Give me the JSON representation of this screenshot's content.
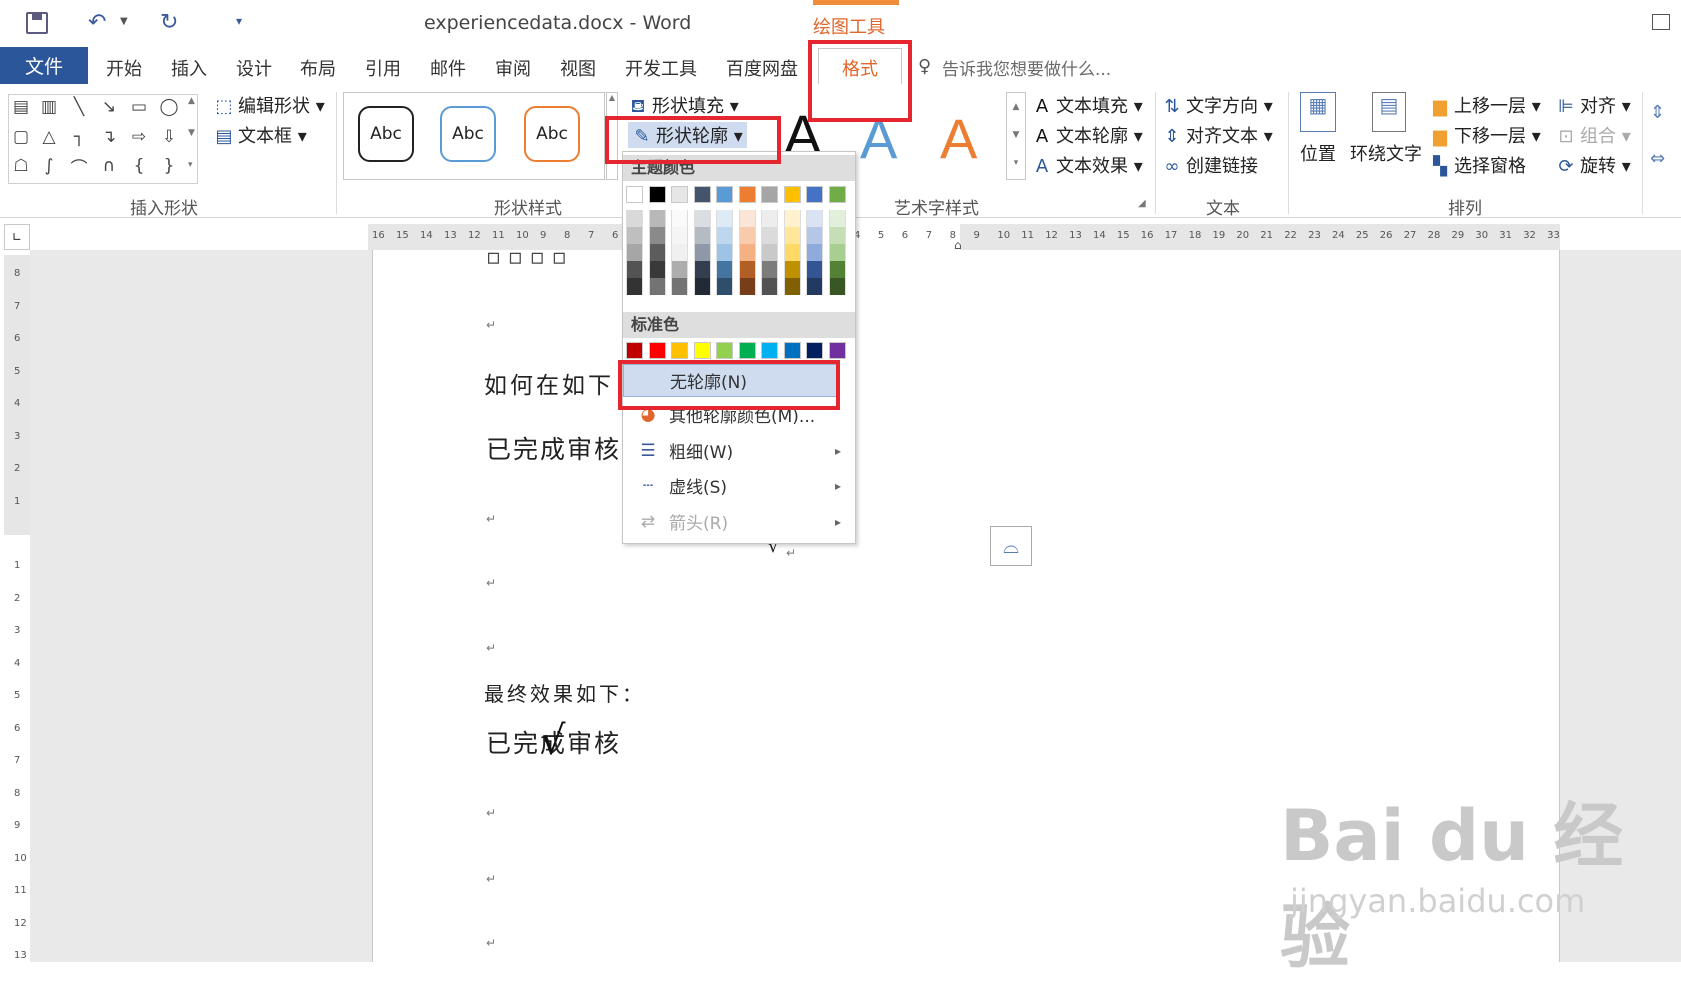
{
  "window": {
    "title": "experiencedata.docx - Word",
    "context_tab_label": "绘图工具"
  },
  "tabs": [
    "文件",
    "开始",
    "插入",
    "设计",
    "布局",
    "引用",
    "邮件",
    "审阅",
    "视图",
    "开发工具",
    "百度网盘",
    "格式"
  ],
  "tell_me": "告诉我您想要做什么...",
  "ribbon": {
    "insert_shapes": {
      "label": "插入形状",
      "edit_shape": "编辑形状",
      "text_box": "文本框"
    },
    "shape_styles": {
      "label": "形状样式",
      "samples": [
        "Abc",
        "Abc",
        "Abc"
      ],
      "fill": "形状填充",
      "outline": "形状轮廓"
    },
    "wordart": {
      "label": "艺术字样式",
      "letters": [
        "A",
        "A",
        "A"
      ],
      "text_fill": "文本填充",
      "text_outline": "文本轮廓",
      "text_effects": "文本效果"
    },
    "text": {
      "label": "文本",
      "direction": "文字方向",
      "align": "对齐文本",
      "link": "创建链接"
    },
    "arrange": {
      "label": "排列",
      "position": "位置",
      "wrap": "环绕文字",
      "forward": "上移一层",
      "backward": "下移一层",
      "pane": "选择窗格",
      "align": "对齐",
      "group": "组合",
      "rotate": "旋转"
    }
  },
  "ruler_h_left": [
    "16",
    "15",
    "14",
    "13",
    "12",
    "11",
    "10",
    "9",
    "8",
    "7",
    "6"
  ],
  "ruler_h_right": [
    "4",
    "5",
    "6",
    "7",
    "8",
    "9",
    "10",
    "11",
    "12",
    "13",
    "14",
    "15",
    "16",
    "17",
    "18",
    "19",
    "20",
    "21",
    "22",
    "23",
    "24",
    "25",
    "26",
    "27",
    "28",
    "29",
    "30",
    "31",
    "32",
    "33"
  ],
  "ruler_v_top": [
    "8",
    "7",
    "6",
    "5",
    "4",
    "3",
    "2",
    "1"
  ],
  "ruler_v_bottom": [
    "1",
    "2",
    "3",
    "4",
    "5",
    "6",
    "7",
    "8",
    "9",
    "10",
    "11",
    "12",
    "13"
  ],
  "document": {
    "p1": "如何在如下",
    "p2": "已完成审核",
    "p3": "最终效果如下：",
    "p4": "已完成审核",
    "pilcrow": "↵",
    "check": "√"
  },
  "menu": {
    "theme_colors_header": "主题颜色",
    "standard_colors_header": "标准色",
    "no_outline": "无轮廓(N)",
    "more_colors": "其他轮廓颜色(M)...",
    "weight": "粗细(W)",
    "dashes": "虚线(S)",
    "arrows": "箭头(R)",
    "theme_top": [
      "#ffffff",
      "#000000",
      "#e7e6e6",
      "#44546a",
      "#5b9bd5",
      "#ed7d31",
      "#a5a5a5",
      "#ffc000",
      "#4472c4",
      "#70ad47"
    ],
    "standard": [
      "#c00000",
      "#ff0000",
      "#ffc000",
      "#ffff00",
      "#92d050",
      "#00b050",
      "#00b0f0",
      "#0070c0",
      "#002060",
      "#7030a0"
    ]
  },
  "watermark": {
    "brand": "Bai du 经验",
    "url": "jingyan.baidu.com"
  }
}
